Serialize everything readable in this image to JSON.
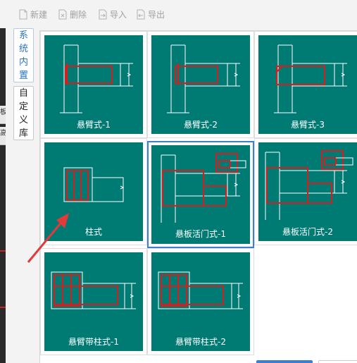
{
  "toolbar": {
    "new_label": "新建",
    "delete_label": "删除",
    "import_label": "导入",
    "export_label": "导出"
  },
  "tabs": [
    {
      "chars": [
        "系",
        "统",
        "内",
        "置"
      ],
      "active": true
    },
    {
      "chars": [
        "自",
        "定",
        "义",
        "库"
      ],
      "active": false
    }
  ],
  "left_strip": {
    "partial_chars": [
      "板",
      "高"
    ]
  },
  "thumbnails": [
    {
      "label": "悬臂式-1",
      "icon": "cantilever-1-diagram"
    },
    {
      "label": "悬臂式-2",
      "icon": "cantilever-2-diagram"
    },
    {
      "label": "悬臂式-3",
      "icon": "cantilever-3-diagram"
    },
    {
      "label": "柱式",
      "icon": "column-diagram"
    },
    {
      "label": "悬板活门式-1",
      "icon": "hanging-plate-door-1-diagram",
      "selected": true
    },
    {
      "label": "悬板活门式-2",
      "icon": "hanging-plate-door-2-diagram"
    },
    {
      "label": "悬臂带柱式-1",
      "icon": "cantilever-with-column-1-diagram"
    },
    {
      "label": "悬臂带柱式-2",
      "icon": "cantilever-with-column-2-diagram"
    }
  ],
  "colors": {
    "thumbnail_bg": "#007b74",
    "drawing_line": "#ffffff",
    "highlight_red": "#d21f1f",
    "selection_blue": "#3a7fd0",
    "active_tab_text": "#2a73c5",
    "disabled_text": "#a0a0a0"
  }
}
